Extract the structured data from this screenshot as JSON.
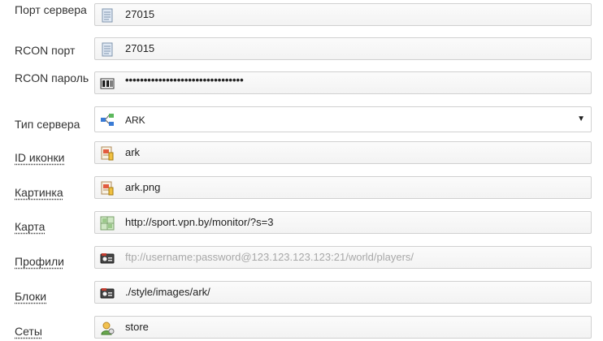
{
  "fields": [
    {
      "label": "Порт сервера",
      "value": "27015",
      "icon": "document-icon"
    },
    {
      "label": "RCON порт",
      "value": "27015",
      "icon": "document-icon"
    },
    {
      "label": "RCON пароль",
      "value": "••••••••••••••••••••••••••••••••",
      "icon": "barcode-icon"
    },
    {
      "label": "Тип сервера",
      "value": "ARK",
      "icon": "server-type-icon"
    },
    {
      "label": "ID иконки",
      "value": "ark",
      "icon": "image-file-icon"
    },
    {
      "label": "Картинка",
      "value": "ark.png",
      "icon": "image-file-icon"
    },
    {
      "label": "Карта",
      "value": "http://sport.vpn.by/monitor/?s=3",
      "icon": "map-icon"
    },
    {
      "label": "Профили",
      "placeholder": "ftp://username:password@123.123.123.123:21/world/players/",
      "icon": "profile-card-icon"
    },
    {
      "label": "Блоки",
      "value": "./style/images/ark/",
      "icon": "profile-card-icon"
    },
    {
      "label": "Сеты",
      "value": "store",
      "icon": "user-sets-icon"
    }
  ],
  "dropdown_caret": "▼"
}
